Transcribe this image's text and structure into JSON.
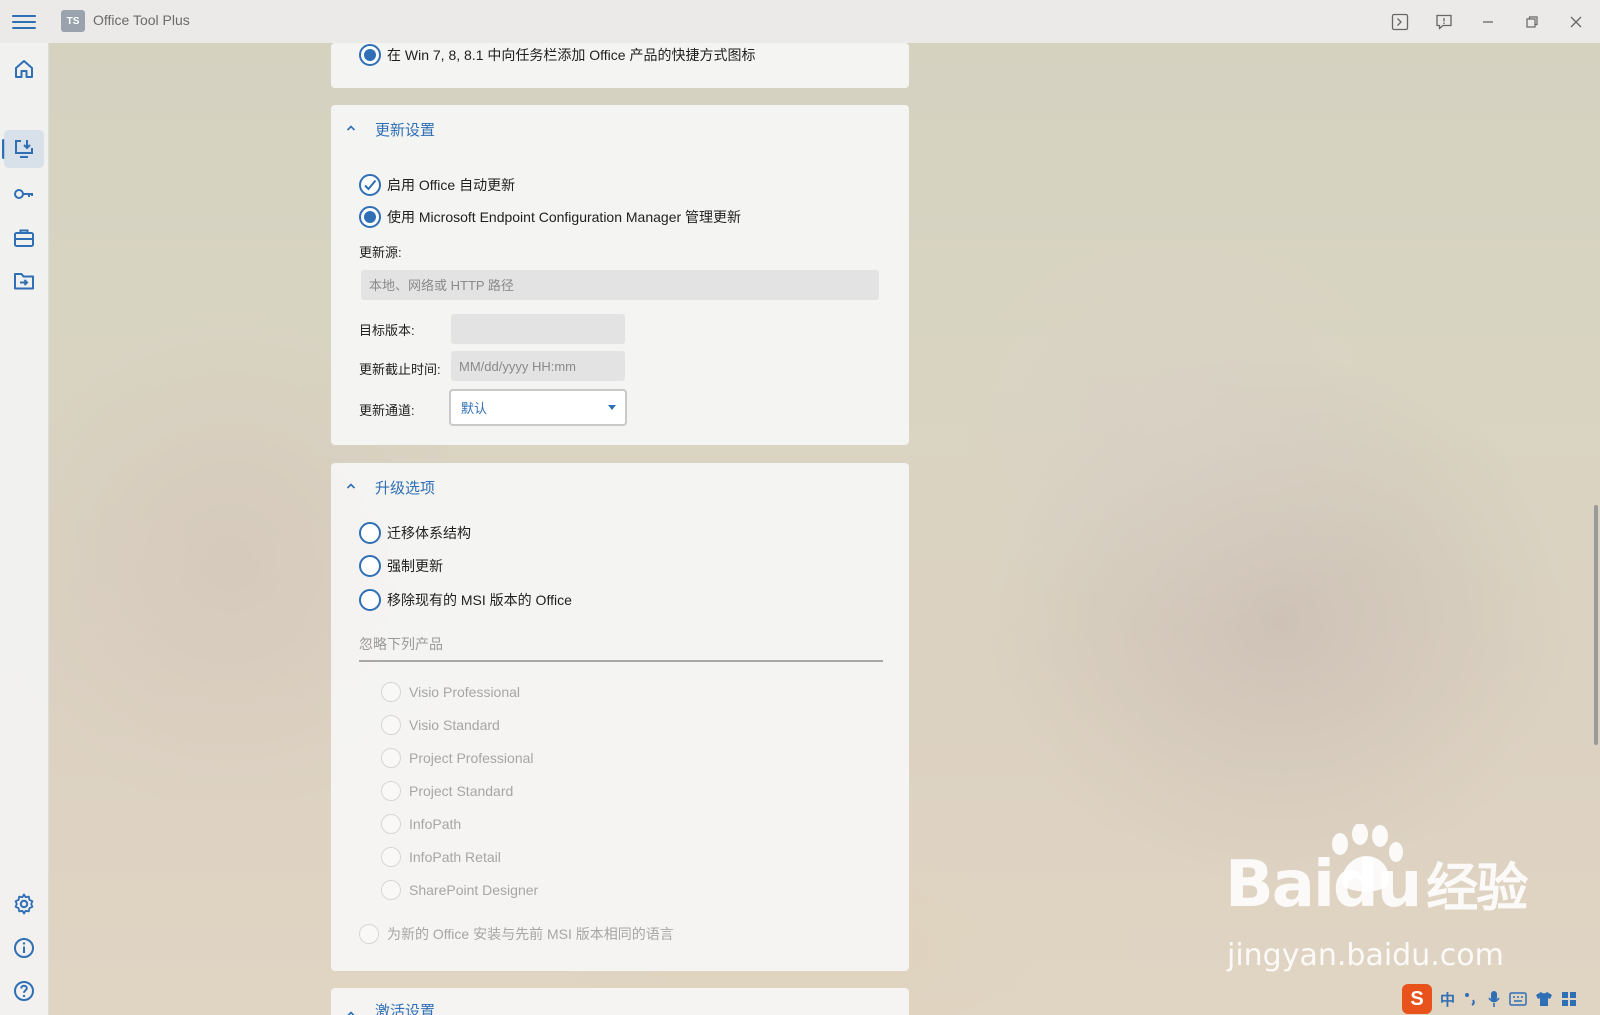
{
  "app": {
    "title": "Office Tool Plus",
    "logo_text": "TS"
  },
  "accent_color": "#2f6fb5",
  "nav": [
    {
      "name": "home",
      "icon": "home-icon"
    },
    {
      "name": "deploy",
      "icon": "download-icon",
      "active": true
    },
    {
      "name": "activate",
      "icon": "key-icon"
    },
    {
      "name": "toolbox",
      "icon": "toolbox-icon"
    },
    {
      "name": "convert",
      "icon": "folder-arrow-icon"
    },
    {
      "name": "settings",
      "icon": "gear-icon"
    },
    {
      "name": "about",
      "icon": "info-icon"
    },
    {
      "name": "help",
      "icon": "help-icon"
    }
  ],
  "top_partial": {
    "option_label": "在 Win 7, 8, 8.1 中向任务栏添加 Office 产品的快捷方式图标"
  },
  "update_settings": {
    "title": "更新设置",
    "enable_auto_update": "启用 Office 自动更新",
    "use_mecm": "使用 Microsoft Endpoint Configuration Manager 管理更新",
    "source_label": "更新源:",
    "source_placeholder": "本地、网络或 HTTP 路径",
    "target_version_label": "目标版本:",
    "target_version_value": "",
    "deadline_label": "更新截止时间:",
    "deadline_placeholder": "MM/dd/yyyy HH:mm",
    "channel_label": "更新通道:",
    "channel_value": "默认"
  },
  "upgrade_options": {
    "title": "升级选项",
    "migrate_arch": "迁移体系结构",
    "force_update": "强制更新",
    "remove_msi": "移除现有的 MSI 版本的 Office",
    "ignore_label": "忽略下列产品",
    "products": [
      "Visio Professional",
      "Visio Standard",
      "Project Professional",
      "Project Standard",
      "InfoPath",
      "InfoPath Retail",
      "SharePoint Designer"
    ],
    "same_language": "为新的 Office 安装与先前 MSI 版本相同的语言"
  },
  "activation_settings": {
    "title": "激活设置"
  },
  "watermark": {
    "brand": "Bai",
    "brand2": "du",
    "cn": "经验",
    "url": "jingyan.baidu.com"
  },
  "ime": {
    "logo": "S",
    "mode": "中"
  }
}
